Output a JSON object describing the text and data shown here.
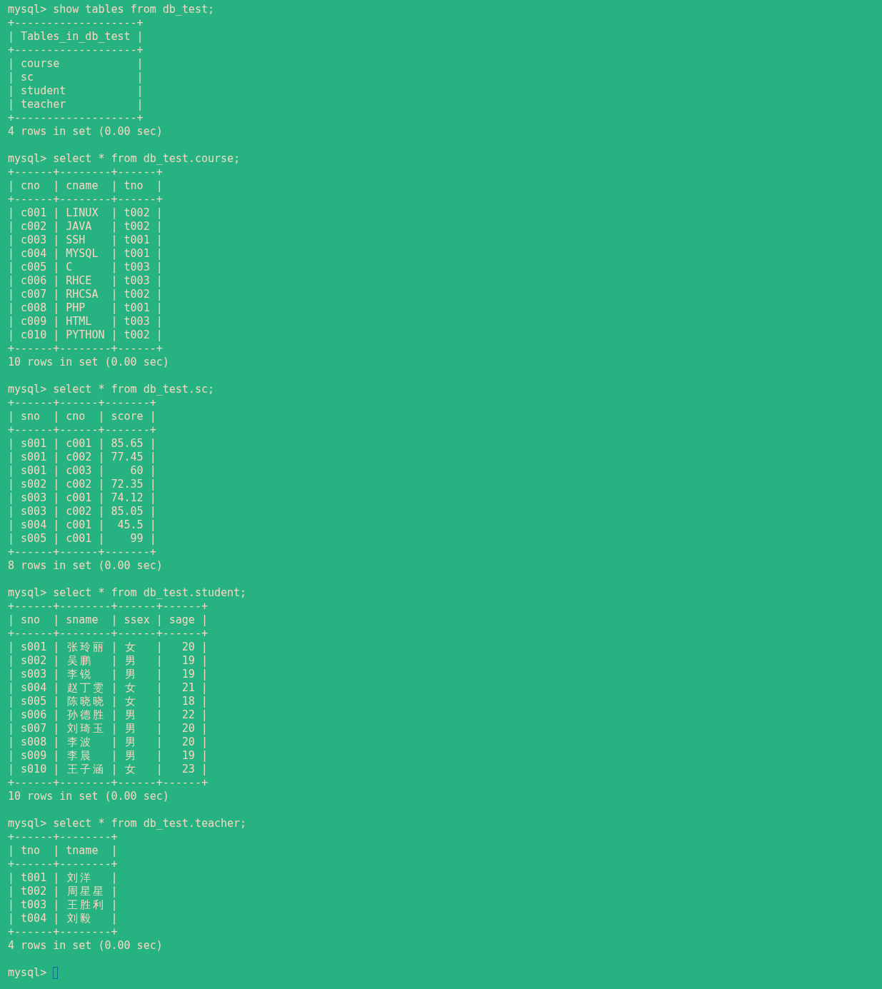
{
  "terminal": {
    "lines": [
      {
        "kind": "prompt",
        "prompt": "mysql>",
        "command": "show tables from db_test;",
        "cursor": false
      },
      {
        "kind": "output",
        "text": "+-------------------+"
      },
      {
        "kind": "output",
        "text": "| Tables_in_db_test |"
      },
      {
        "kind": "output",
        "text": "+-------------------+"
      },
      {
        "kind": "output",
        "text": "| course            |"
      },
      {
        "kind": "output",
        "text": "| sc                |"
      },
      {
        "kind": "output",
        "text": "| student           |"
      },
      {
        "kind": "output",
        "text": "| teacher           |"
      },
      {
        "kind": "output",
        "text": "+-------------------+"
      },
      {
        "kind": "output",
        "text": "4 rows in set (0.00 sec)"
      },
      {
        "kind": "blank"
      },
      {
        "kind": "prompt",
        "prompt": "mysql>",
        "command": "select * from db_test.course;",
        "cursor": false
      },
      {
        "kind": "output",
        "text": "+------+--------+------+"
      },
      {
        "kind": "output",
        "text": "| cno  | cname  | tno  |"
      },
      {
        "kind": "output",
        "text": "+------+--------+------+"
      },
      {
        "kind": "output",
        "text": "| c001 | LINUX  | t002 |"
      },
      {
        "kind": "output",
        "text": "| c002 | JAVA   | t002 |"
      },
      {
        "kind": "output",
        "text": "| c003 | SSH    | t001 |"
      },
      {
        "kind": "output",
        "text": "| c004 | MYSQL  | t001 |"
      },
      {
        "kind": "output",
        "text": "| c005 | C      | t003 |"
      },
      {
        "kind": "output",
        "text": "| c006 | RHCE   | t003 |"
      },
      {
        "kind": "output",
        "text": "| c007 | RHCSA  | t002 |"
      },
      {
        "kind": "output",
        "text": "| c008 | PHP    | t001 |"
      },
      {
        "kind": "output",
        "text": "| c009 | HTML   | t003 |"
      },
      {
        "kind": "output",
        "text": "| c010 | PYTHON | t002 |"
      },
      {
        "kind": "output",
        "text": "+------+--------+------+"
      },
      {
        "kind": "output",
        "text": "10 rows in set (0.00 sec)"
      },
      {
        "kind": "blank"
      },
      {
        "kind": "prompt",
        "prompt": "mysql>",
        "command": "select * from db_test.sc;",
        "cursor": false
      },
      {
        "kind": "output",
        "text": "+------+------+-------+"
      },
      {
        "kind": "output",
        "text": "| sno  | cno  | score |"
      },
      {
        "kind": "output",
        "text": "+------+------+-------+"
      },
      {
        "kind": "output",
        "text": "| s001 | c001 | 85.65 |"
      },
      {
        "kind": "output",
        "text": "| s001 | c002 | 77.45 |"
      },
      {
        "kind": "output",
        "text": "| s001 | c003 |    60 |"
      },
      {
        "kind": "output",
        "text": "| s002 | c002 | 72.35 |"
      },
      {
        "kind": "output",
        "text": "| s003 | c001 | 74.12 |"
      },
      {
        "kind": "output",
        "text": "| s003 | c002 | 85.05 |"
      },
      {
        "kind": "output",
        "text": "| s004 | c001 |  45.5 |"
      },
      {
        "kind": "output",
        "text": "| s005 | c001 |    99 |"
      },
      {
        "kind": "output",
        "text": "+------+------+-------+"
      },
      {
        "kind": "output",
        "text": "8 rows in set (0.00 sec)"
      },
      {
        "kind": "blank"
      },
      {
        "kind": "prompt",
        "prompt": "mysql>",
        "command": "select * from db_test.student;",
        "cursor": false
      },
      {
        "kind": "output",
        "text": "+------+--------+------+------+"
      },
      {
        "kind": "output",
        "text": "| sno  | sname  | ssex | sage |"
      },
      {
        "kind": "output",
        "text": "+------+--------+------+------+"
      },
      {
        "kind": "output",
        "text": "| s001 | 张玲丽 | 女   |   20 |"
      },
      {
        "kind": "output",
        "text": "| s002 | 吴鹏   | 男   |   19 |"
      },
      {
        "kind": "output",
        "text": "| s003 | 李锐   | 男   |   19 |"
      },
      {
        "kind": "output",
        "text": "| s004 | 赵丁雯 | 女   |   21 |"
      },
      {
        "kind": "output",
        "text": "| s005 | 陈晓晓 | 女   |   18 |"
      },
      {
        "kind": "output",
        "text": "| s006 | 孙德胜 | 男   |   22 |"
      },
      {
        "kind": "output",
        "text": "| s007 | 刘琦玉 | 男   |   20 |"
      },
      {
        "kind": "output",
        "text": "| s008 | 李波   | 男   |   20 |"
      },
      {
        "kind": "output",
        "text": "| s009 | 李晨   | 男   |   19 |"
      },
      {
        "kind": "output",
        "text": "| s010 | 王子涵 | 女   |   23 |"
      },
      {
        "kind": "output",
        "text": "+------+--------+------+------+"
      },
      {
        "kind": "output",
        "text": "10 rows in set (0.00 sec)"
      },
      {
        "kind": "blank"
      },
      {
        "kind": "prompt",
        "prompt": "mysql>",
        "command": "select * from db_test.teacher;",
        "cursor": false
      },
      {
        "kind": "output",
        "text": "+------+--------+"
      },
      {
        "kind": "output",
        "text": "| tno  | tname  |"
      },
      {
        "kind": "output",
        "text": "+------+--------+"
      },
      {
        "kind": "output",
        "text": "| t001 | 刘洋   |"
      },
      {
        "kind": "output",
        "text": "| t002 | 周星星 |"
      },
      {
        "kind": "output",
        "text": "| t003 | 王胜利 |"
      },
      {
        "kind": "output",
        "text": "| t004 | 刘毅   |"
      },
      {
        "kind": "output",
        "text": "+------+--------+"
      },
      {
        "kind": "output",
        "text": "4 rows in set (0.00 sec)"
      },
      {
        "kind": "blank"
      },
      {
        "kind": "prompt",
        "prompt": "mysql>",
        "cursor": true
      }
    ]
  }
}
